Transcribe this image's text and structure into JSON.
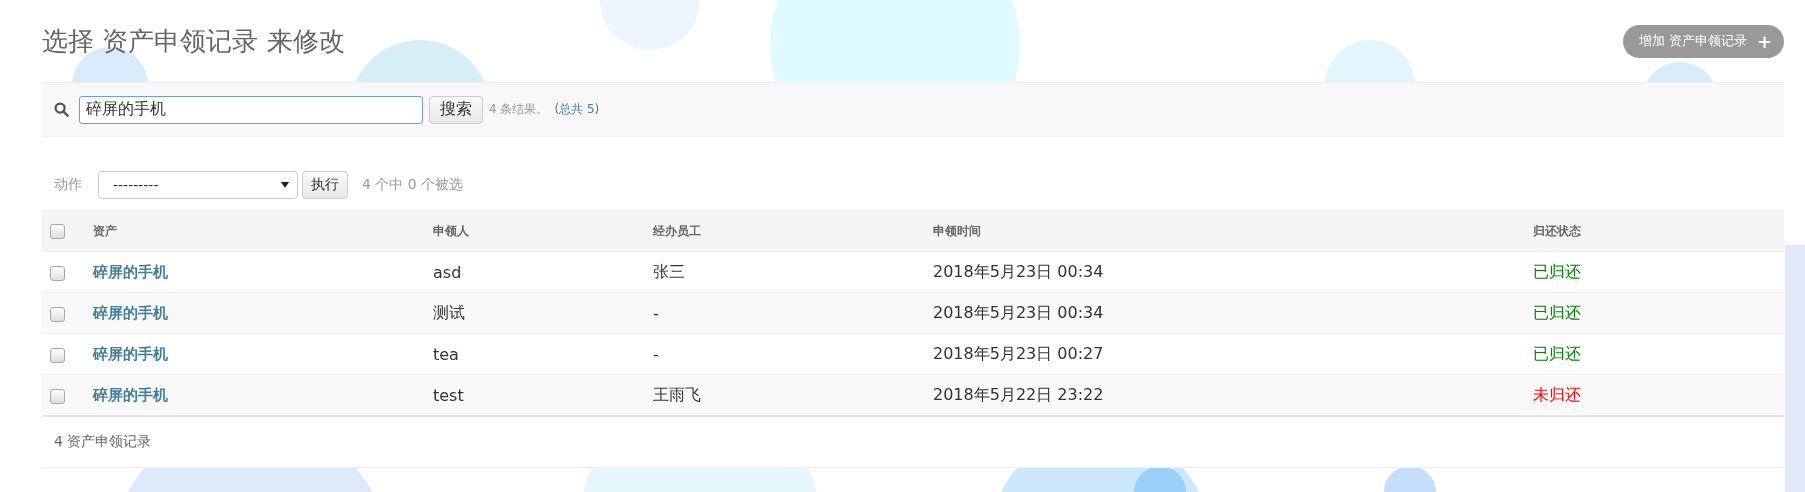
{
  "title": "选择 资产申领记录 来修改",
  "add_button": {
    "label": "增加 资产申领记录",
    "icon": "+"
  },
  "search": {
    "value": "碎屏的手机",
    "button": "搜索",
    "result_count": "4 条结果。",
    "total": "(总共 5)"
  },
  "actions": {
    "label": "动作",
    "select_value": "---------",
    "run_button": "执行",
    "selection_count": "4 个中 0 个被选"
  },
  "table": {
    "columns": [
      "资产",
      "申领人",
      "经办员工",
      "申领时间",
      "归还状态"
    ],
    "all_checked": false,
    "rows": [
      {
        "checked": false,
        "asset": "碎屏的手机",
        "applicant": "asd",
        "staff": "张三",
        "time": "2018年5月23日 00:34",
        "status": "已归还",
        "returned": true
      },
      {
        "checked": false,
        "asset": "碎屏的手机",
        "applicant": "测试",
        "staff": "-",
        "time": "2018年5月23日 00:34",
        "status": "已归还",
        "returned": true
      },
      {
        "checked": false,
        "asset": "碎屏的手机",
        "applicant": "tea",
        "staff": "-",
        "time": "2018年5月23日 00:27",
        "status": "已归还",
        "returned": true
      },
      {
        "checked": false,
        "asset": "碎屏的手机",
        "applicant": "test",
        "staff": "王雨飞",
        "time": "2018年5月22日 23:22",
        "status": "未归还",
        "returned": false
      }
    ]
  },
  "footer": "4 资产申领记录"
}
